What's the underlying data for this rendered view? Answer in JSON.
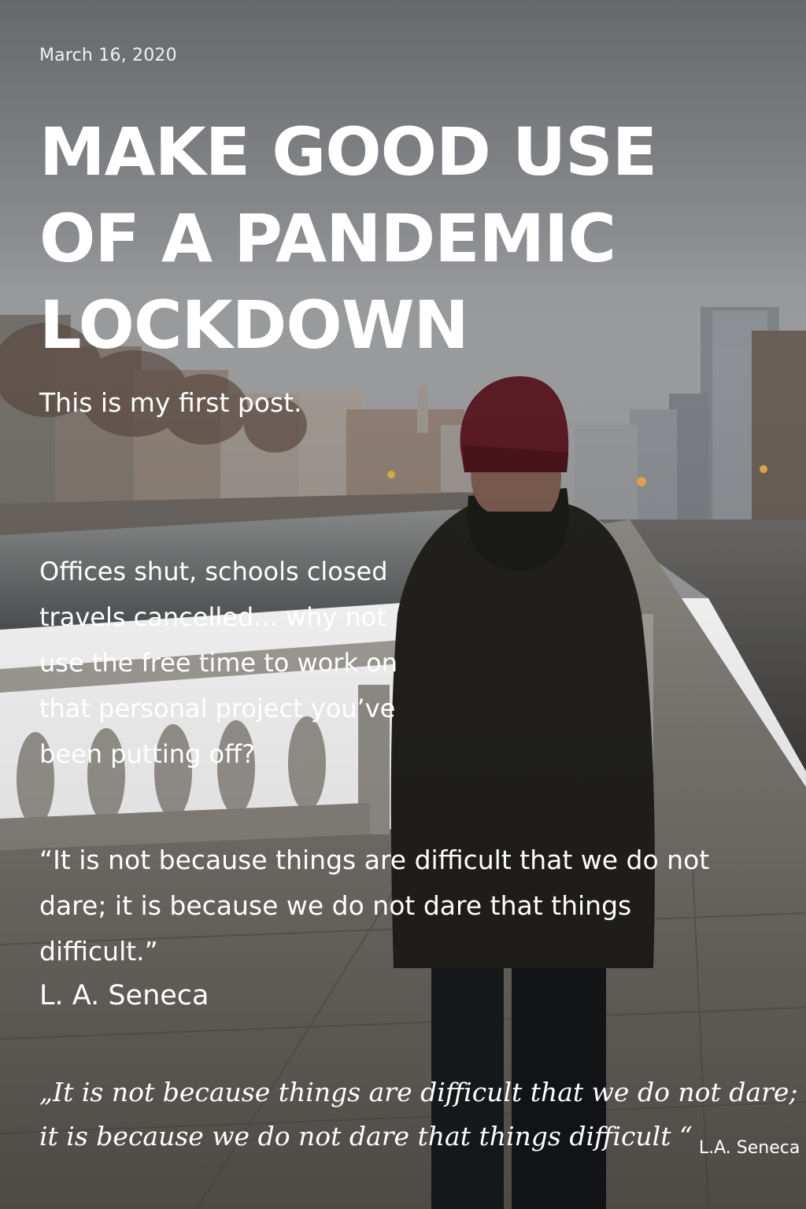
{
  "post": {
    "date": "March 16, 2020",
    "title_lines": [
      "MAKE GOOD USE",
      "OF A PANDEMIC",
      "LOCKDOWN"
    ],
    "intro": "This is my first post.",
    "body_lines": [
      "Offices shut, schools closed",
      "travels cancelled... why not",
      "use the free time to work on",
      "that personal project you’ve",
      "been putting off?"
    ],
    "quote_lines": [
      "“It is not because things are difficult that we do not",
      "dare; it is because we do not dare that things",
      "difficult.”"
    ],
    "quote_author": "L. A. Seneca",
    "pullquote_lines": [
      "„It is not because things are difficult that we do not dare;",
      "it is because we do not dare that things difficult “"
    ],
    "pullquote_author": "L.A. Seneca"
  },
  "colors": {
    "text": "#ffffff",
    "sky": "#7d7f83",
    "hat": "#5a1b24",
    "jacket": "#1f1e1a"
  }
}
